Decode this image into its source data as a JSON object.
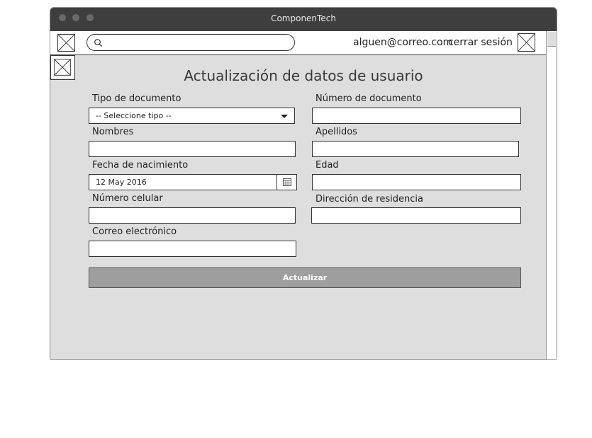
{
  "window": {
    "title": "ComponenTech"
  },
  "navbar": {
    "search_placeholder": "",
    "user_email": "alguen@correo.com",
    "logout_label": "cerrar sesión"
  },
  "form": {
    "heading": "Actualización de datos de usuario",
    "document_type": {
      "label": "Tipo de documento",
      "value": "-- Seleccione tipo --"
    },
    "document_number": {
      "label": "Número de documento",
      "value": ""
    },
    "first_names": {
      "label": "Nombres",
      "value": ""
    },
    "last_names": {
      "label": "Apellidos",
      "value": ""
    },
    "birth_date": {
      "label": "Fecha de nacimiento",
      "value": "12 May 2016"
    },
    "age": {
      "label": "Edad",
      "value": ""
    },
    "mobile": {
      "label": "Número celular",
      "value": ""
    },
    "address": {
      "label": "Dirección de residencia",
      "value": ""
    },
    "email": {
      "label": "Correo electrónico",
      "value": ""
    },
    "submit_label": "Actualizar"
  },
  "colors": {
    "titlebar": "#3e3e3e",
    "canvas": "#dedede",
    "button": "#9e9e9e"
  }
}
